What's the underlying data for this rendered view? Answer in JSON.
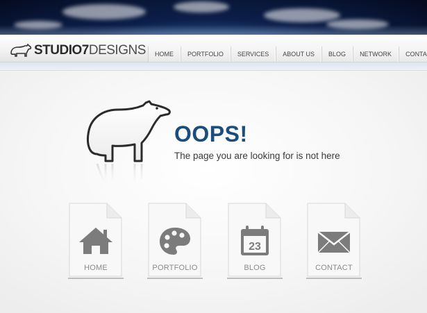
{
  "logo": {
    "bold": "STUDIO7",
    "light": "DESIGNS"
  },
  "nav": [
    "HOME",
    "PORTFOLIO",
    "SERVICES",
    "ABOUT US",
    "BLOG",
    "NETWORK",
    "CONTACT"
  ],
  "error": {
    "title": "OOPS!",
    "message": "The page you are looking for is not here"
  },
  "cards": [
    {
      "label": "HOME",
      "icon": "house-icon"
    },
    {
      "label": "PORTFOLIO",
      "icon": "palette-icon"
    },
    {
      "label": "BLOG",
      "icon": "calendar-icon",
      "calendar_day": "23"
    },
    {
      "label": "CONTACT",
      "icon": "envelope-icon"
    }
  ],
  "colors": {
    "title": "#1d4d7c",
    "icon": "#7c7c7c",
    "text": "#3a3a3a"
  }
}
